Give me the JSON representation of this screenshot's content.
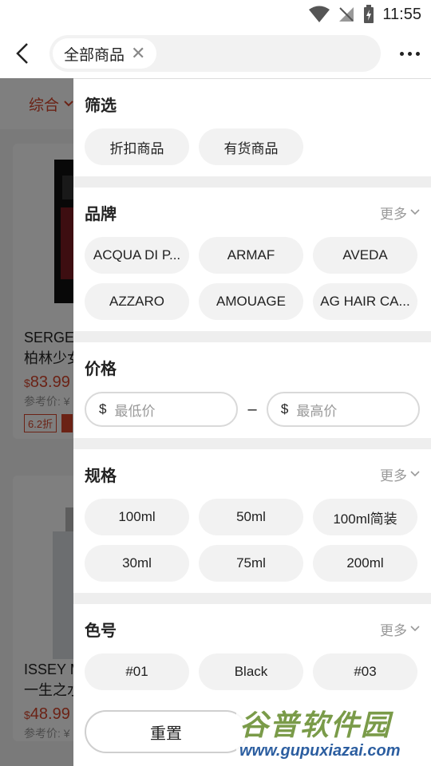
{
  "status_bar": {
    "time": "11:55"
  },
  "header": {
    "search_chip": "全部商品",
    "chip_close": "✕"
  },
  "background": {
    "sort_label": "综合",
    "products": [
      {
        "title": "SERGE",
        "subtitle": "柏林少女",
        "price": "83.99",
        "currency": "$",
        "ref": "参考价: ¥",
        "discount": "6.2折"
      },
      {
        "title": "ISSEY M",
        "subtitle": "一生之水",
        "price": "48.99",
        "currency": "$",
        "ref": "参考价: ¥",
        "discount": ""
      }
    ]
  },
  "drawer": {
    "filter": {
      "title": "筛选",
      "options": [
        "折扣商品",
        "有货商品"
      ]
    },
    "brand": {
      "title": "品牌",
      "more": "更多",
      "options": [
        "ACQUA DI P...",
        "ARMAF",
        "AVEDA",
        "AZZARO",
        "AMOUAGE",
        "AG HAIR CA..."
      ]
    },
    "price": {
      "title": "价格",
      "currency": "$",
      "min_placeholder": "最低价",
      "max_placeholder": "最高价",
      "dash": "–"
    },
    "spec": {
      "title": "规格",
      "more": "更多",
      "options": [
        "100ml",
        "50ml",
        "100ml简装",
        "30ml",
        "75ml",
        "200ml"
      ]
    },
    "shade": {
      "title": "色号",
      "more": "更多",
      "options": [
        "#01",
        "Black",
        "#03"
      ]
    },
    "footer": {
      "reset": "重置"
    }
  },
  "watermark": {
    "top": "谷普软件园",
    "bottom": "www.gupuxiazai.com"
  }
}
